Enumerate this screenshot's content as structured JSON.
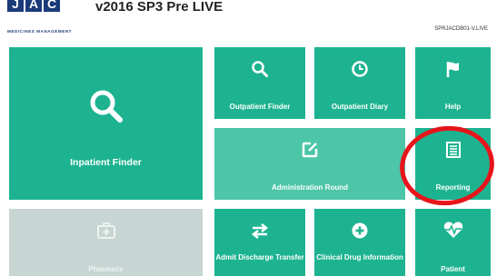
{
  "header": {
    "logo_text": "JAC",
    "logo_subtitle": "MEDICINES MANAGEMENT",
    "title": "v2016 SP3 Pre LIVE",
    "server": "SPRJACDB01-V.LIVE"
  },
  "tiles": {
    "inpatient_finder": "Inpatient Finder",
    "outpatient_finder": "Outpatient Finder",
    "outpatient_diary": "Outpatient Diary",
    "help": "Help",
    "administration_round": "Administration Round",
    "reporting": "Reporting",
    "pharmacy": "Pharmacy",
    "admit_discharge_transfer": "Admit Discharge Transfer",
    "clinical_drug_information": "Clinical Drug Information",
    "patient": "Patient"
  },
  "colors": {
    "tile": "#1db390",
    "tile_light": "#4cc6a7",
    "tile_disabled": "#c7d5d3",
    "annotation": "#e8141b"
  },
  "icons": {
    "inpatient_finder": "search-icon",
    "outpatient_finder": "search-icon",
    "outpatient_diary": "clock-icon",
    "help": "flag-icon",
    "administration_round": "edit-icon",
    "reporting": "list-icon",
    "pharmacy": "medical-kit-icon",
    "admit_discharge_transfer": "transfer-icon",
    "clinical_drug_information": "plus-circle-icon",
    "patient": "heartbeat-icon"
  }
}
